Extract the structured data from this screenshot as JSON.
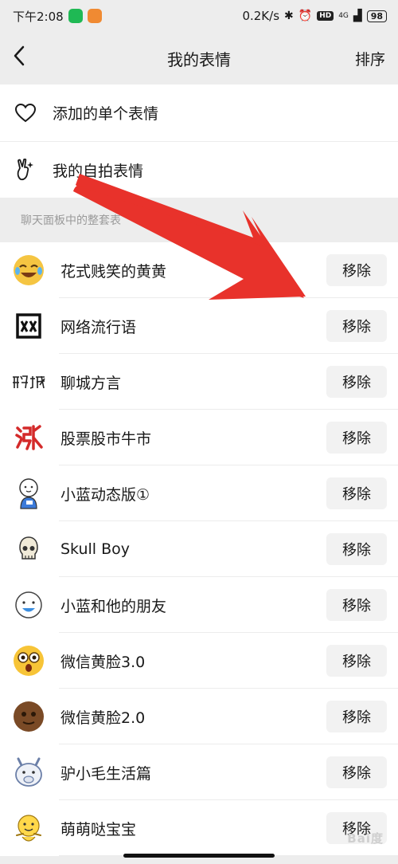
{
  "status_bar": {
    "time": "下午2:08",
    "network_speed": "0.2K/s",
    "network_type": "4G",
    "battery": "98"
  },
  "header": {
    "title": "我的表情",
    "sort_label": "排序"
  },
  "menu": {
    "items": [
      {
        "label": "添加的单个表情",
        "icon": "heart-outline-icon"
      },
      {
        "label": "我的自拍表情",
        "icon": "peace-hand-icon"
      }
    ]
  },
  "section_header": "聊天面板中的整套表",
  "packs": [
    {
      "name": "花式贱笑的黄黄",
      "icon": "laughing-face-icon",
      "button": "移除"
    },
    {
      "name": "网络流行语",
      "icon": "wang-character-icon",
      "button": "移除"
    },
    {
      "name": "聊城方言",
      "icon": "liaocheng-text-icon",
      "button": "移除"
    },
    {
      "name": "股票股市牛市",
      "icon": "zhang-character-icon",
      "button": "移除"
    },
    {
      "name": "小蓝动态版①",
      "icon": "blue-character-icon",
      "button": "移除"
    },
    {
      "name": "Skull Boy",
      "icon": "skull-icon",
      "button": "移除"
    },
    {
      "name": "小蓝和他的朋友",
      "icon": "blue-face-icon",
      "button": "移除"
    },
    {
      "name": "微信黄脸3.0",
      "icon": "surprised-face-icon",
      "button": "移除"
    },
    {
      "name": "微信黄脸2.0",
      "icon": "brown-face-icon",
      "button": "移除"
    },
    {
      "name": "驴小毛生活篇",
      "icon": "donkey-icon",
      "button": "移除"
    },
    {
      "name": "萌萌哒宝宝",
      "icon": "baby-icon",
      "button": "移除"
    }
  ],
  "colors": {
    "background": "#ededed",
    "arrow": "#e8322b",
    "button_bg": "#f2f2f2"
  }
}
